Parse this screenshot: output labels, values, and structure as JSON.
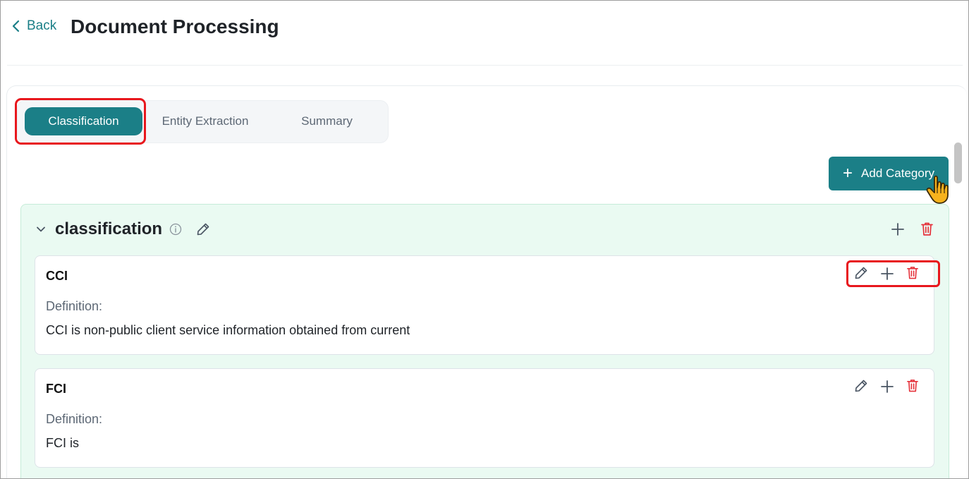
{
  "header": {
    "back_label": "Back",
    "title": "Document Processing"
  },
  "tabs": [
    {
      "label": "Classification",
      "active": true
    },
    {
      "label": "Entity Extraction",
      "active": false
    },
    {
      "label": "Summary",
      "active": false
    }
  ],
  "toolbar": {
    "add_category_label": "Add Category"
  },
  "category": {
    "name": "classification",
    "items": [
      {
        "name": "CCI",
        "definition_label": "Definition:",
        "definition": "CCI is non-public client service information obtained from current"
      },
      {
        "name": "FCI",
        "definition_label": "Definition:",
        "definition": "FCI is"
      }
    ]
  },
  "colors": {
    "accent": "#1b7f87",
    "delete": "#e5323b",
    "category_bg": "#eafaf2",
    "annotation": "#e8171d"
  },
  "icons": {
    "back": "chevron-left-icon",
    "collapse": "chevron-down-icon",
    "info": "info-icon",
    "edit": "pencil-icon",
    "add": "plus-icon",
    "delete": "trash-icon",
    "cursor": "hand-pointer-icon"
  }
}
